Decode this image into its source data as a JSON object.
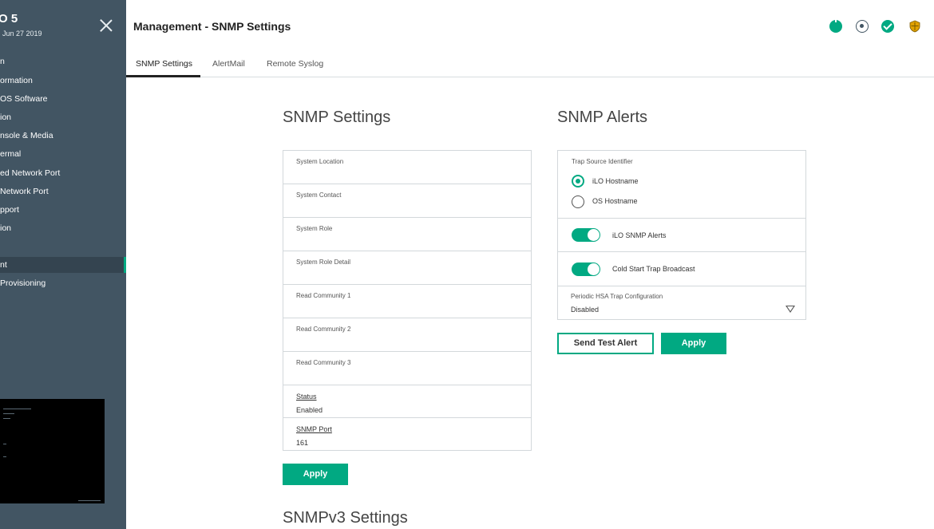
{
  "sidebar": {
    "title": "O 5",
    "date": "Jun 27 2019",
    "items": [
      {
        "label": "n"
      },
      {
        "label": "ormation"
      },
      {
        "label": "OS Software"
      },
      {
        "label": "ion"
      },
      {
        "label": "nsole & Media"
      },
      {
        "label": "ermal"
      },
      {
        "label": "ed Network Port"
      },
      {
        "label": "Network Port"
      },
      {
        "label": "pport"
      },
      {
        "label": "ion"
      },
      {
        "label": "nt"
      },
      {
        "label": "Provisioning"
      }
    ]
  },
  "header": {
    "title": "Management - SNMP Settings",
    "icons": [
      "power-icon",
      "uid-locate-icon",
      "health-ok-icon",
      "security-shield-icon"
    ],
    "colors": {
      "accent": "#01a982",
      "sidebar": "#425563",
      "shield": "#e0a100"
    }
  },
  "tabs": [
    {
      "label": "SNMP Settings",
      "active": true
    },
    {
      "label": "AlertMail",
      "active": false
    },
    {
      "label": "Remote Syslog",
      "active": false
    }
  ],
  "snmp_settings": {
    "heading": "SNMP Settings",
    "fields": [
      {
        "label": "System Location",
        "value": ""
      },
      {
        "label": "System Contact",
        "value": ""
      },
      {
        "label": "System Role",
        "value": ""
      },
      {
        "label": "System Role Detail",
        "value": ""
      },
      {
        "label": "Read Community 1",
        "value": ""
      },
      {
        "label": "Read Community 2",
        "value": ""
      },
      {
        "label": "Read Community 3",
        "value": ""
      },
      {
        "label": "Status",
        "value": "Enabled"
      },
      {
        "label": "SNMP Port",
        "value": "161"
      }
    ],
    "apply_label": "Apply"
  },
  "snmp_alerts": {
    "heading": "SNMP Alerts",
    "trap_source_label": "Trap Source Identifier",
    "trap_source_options": [
      {
        "label": "iLO Hostname",
        "selected": true
      },
      {
        "label": "OS Hostname",
        "selected": false
      }
    ],
    "ilo_snmp_alerts_label": "iLO SNMP Alerts",
    "ilo_snmp_alerts_on": true,
    "cold_start_label": "Cold Start Trap Broadcast",
    "cold_start_on": true,
    "periodic_hsa_label": "Periodic HSA Trap Configuration",
    "periodic_hsa_value": "Disabled",
    "send_test_label": "Send Test Alert",
    "apply_label": "Apply"
  },
  "snmpv3": {
    "heading": "SNMPv3 Settings"
  }
}
